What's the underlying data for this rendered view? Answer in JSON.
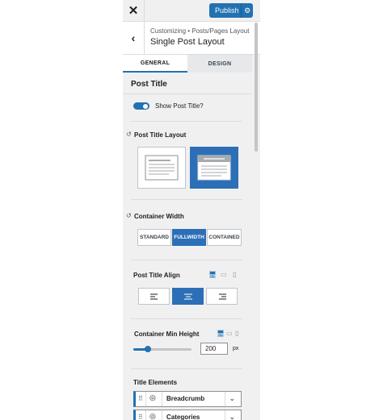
{
  "topbar": {
    "close_label": "✕",
    "publish_label": "Publish",
    "gear": "⚙"
  },
  "header": {
    "back_label": "‹",
    "breadcrumb": "Customizing • Posts/Pages Layout",
    "title": "Single Post Layout"
  },
  "tabs": [
    {
      "label": "GENERAL",
      "active": true
    },
    {
      "label": "DESIGN",
      "active": false
    }
  ],
  "post_title": {
    "heading": "Post Title",
    "show_toggle_label": "Show Post Title?",
    "show_toggle_on": true
  },
  "title_layout": {
    "label": "Post Title Layout",
    "reset_icon": "↺",
    "options": [
      "normal",
      "above"
    ],
    "selected": "above"
  },
  "container_width": {
    "label": "Container Width",
    "reset_icon": "↺",
    "options": [
      "STANDARD",
      "FULLWIDTH",
      "CONTAINED"
    ],
    "selected": "FULLWIDTH"
  },
  "title_align": {
    "label": "Post Title Align",
    "options": [
      "left",
      "center",
      "right"
    ],
    "selected": "center"
  },
  "min_height": {
    "label": "Container Min Height",
    "value": "200",
    "unit": "px",
    "slider_fraction": 0.25
  },
  "devices": {
    "desktop": "🖥",
    "tablet": "▭",
    "mobile": "▯"
  },
  "title_elements": {
    "label": "Title Elements",
    "items": [
      {
        "name": "Breadcrumb"
      },
      {
        "name": "Categories"
      }
    ]
  },
  "colors": {
    "accent": "#2271b1",
    "selected": "#2c6fb7"
  }
}
